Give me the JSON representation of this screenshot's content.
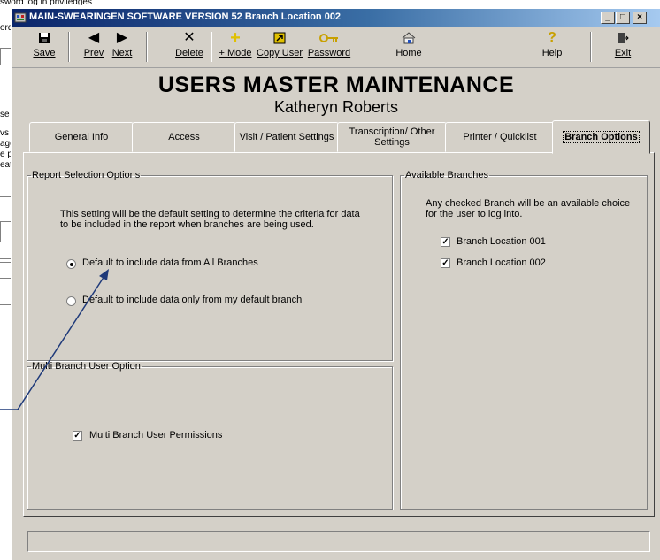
{
  "background_window": {
    "top_text": "sword log in priviledges",
    "fragments": [
      "ord",
      "se",
      "vs",
      "age",
      "e p",
      "eat"
    ]
  },
  "window": {
    "title": "MAIN-SWEARINGEN SOFTWARE VERSION 52   Branch Location 002",
    "minimize": "_",
    "maximize": "□",
    "close": "×"
  },
  "toolbar": {
    "save": "Save",
    "prev": "Prev",
    "next": "Next",
    "delete": "Delete",
    "mode": "+ Mode",
    "copy_user": "Copy User",
    "password": "Password",
    "home": "Home",
    "help": "Help",
    "exit": "Exit"
  },
  "header": {
    "title": "USERS MASTER MAINTENANCE",
    "user_name": "Katheryn Roberts"
  },
  "tabs": [
    {
      "label": "General Info"
    },
    {
      "label": "Access"
    },
    {
      "label": "Visit / Patient Settings"
    },
    {
      "label": "Transcription/ Other Settings"
    },
    {
      "label": "Printer / Quicklist"
    },
    {
      "label": "Branch Options"
    }
  ],
  "report_selection": {
    "legend": "Report Selection Options",
    "description": "This setting will be the default setting to determine the criteria for data to be included in the report when branches are being used.",
    "option_all": "Default to include data from All Branches",
    "option_default": "Default to include data only from my default branch",
    "selected": "all"
  },
  "multi_branch": {
    "legend": "Multi Branch User Option",
    "permissions_label": "Multi Branch User Permissions",
    "permissions_checked": true
  },
  "available_branches": {
    "legend": "Available Branches",
    "description": "Any checked Branch will be an available choice for the user to log into.",
    "branches": [
      {
        "label": "Branch Location 001",
        "checked": true
      },
      {
        "label": "Branch Location 002",
        "checked": true
      }
    ]
  },
  "colors": {
    "titlebar_start": "#0a246a",
    "window_face": "#d4d0c8",
    "annotation_arrow": "#1f3a7a"
  }
}
